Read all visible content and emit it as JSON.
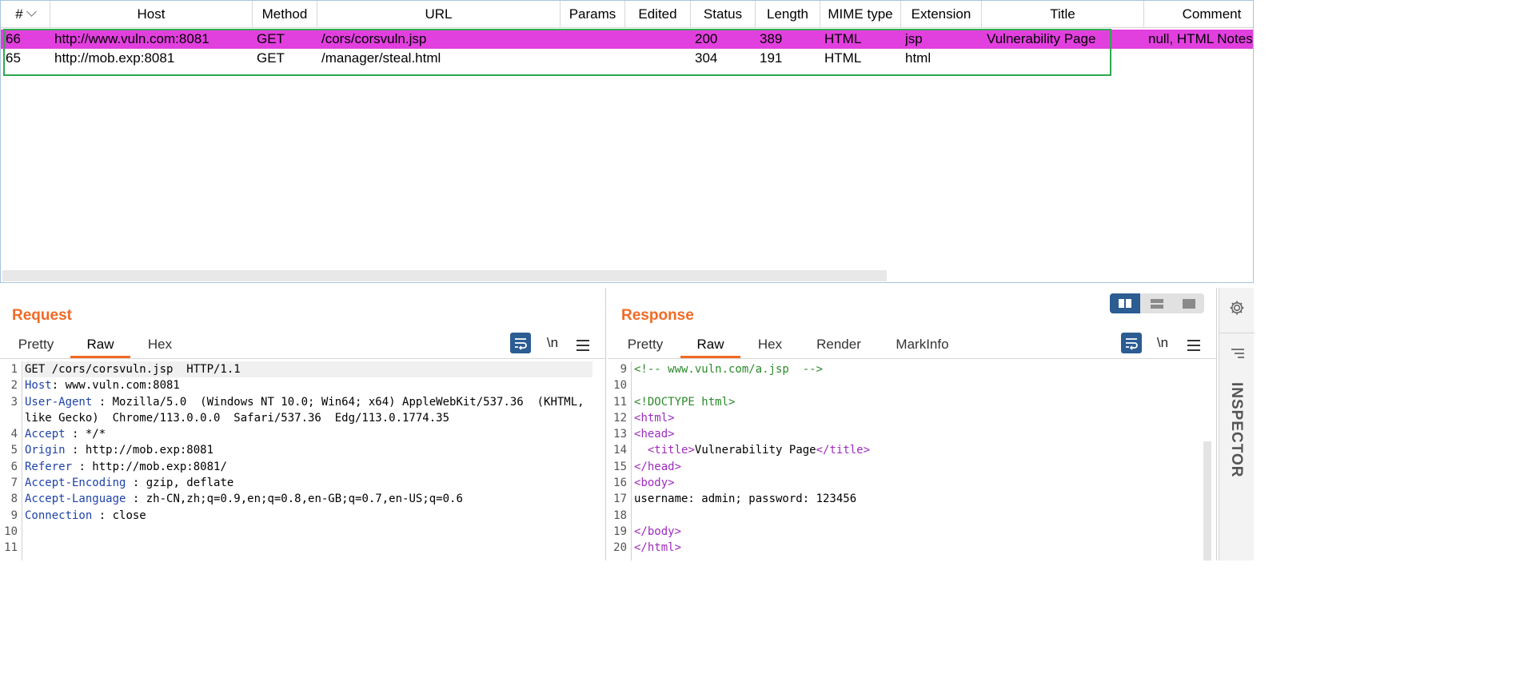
{
  "table": {
    "columns": [
      {
        "key": "num",
        "label": "#"
      },
      {
        "key": "host",
        "label": "Host"
      },
      {
        "key": "method",
        "label": "Method"
      },
      {
        "key": "url",
        "label": "URL"
      },
      {
        "key": "params",
        "label": "Params"
      },
      {
        "key": "edited",
        "label": "Edited"
      },
      {
        "key": "status",
        "label": "Status"
      },
      {
        "key": "length",
        "label": "Length"
      },
      {
        "key": "mime",
        "label": "MIME type"
      },
      {
        "key": "ext",
        "label": "Extension"
      },
      {
        "key": "title",
        "label": "Title"
      },
      {
        "key": "comment",
        "label": "Comment"
      }
    ],
    "rows": [
      {
        "num": "66",
        "host": "http://www.vuln.com:8081",
        "method": "GET",
        "url": "/cors/corsvuln.jsp",
        "params": "",
        "edited": "",
        "status": "200",
        "length": "389",
        "mime": "HTML",
        "ext": "jsp",
        "title": "Vulnerability Page",
        "comment": "null, HTML Notes",
        "selected": true
      },
      {
        "num": "65",
        "host": "http://mob.exp:8081",
        "method": "GET",
        "url": "/manager/steal.html",
        "params": "",
        "edited": "",
        "status": "304",
        "length": "191",
        "mime": "HTML",
        "ext": "html",
        "title": "",
        "comment": "",
        "selected": false
      }
    ]
  },
  "request": {
    "title": "Request",
    "tabs": [
      "Pretty",
      "Raw",
      "Hex"
    ],
    "active_tab": "Raw",
    "newline_label": "\\n",
    "lines": [
      {
        "n": "1",
        "parts": [
          {
            "t": "GET /cors/corsvuln.jsp  HTTP/1.1",
            "c": ""
          }
        ]
      },
      {
        "n": "2",
        "parts": [
          {
            "t": "Host",
            "c": "key"
          },
          {
            "t": ": www.vuln.com:8081",
            "c": ""
          }
        ]
      },
      {
        "n": "3",
        "parts": [
          {
            "t": "User-Agent",
            "c": "key"
          },
          {
            "t": " : Mozilla/5.0  (Windows NT 10.0; Win64; x64) AppleWebKit/537.36  (KHTML,",
            "c": ""
          }
        ]
      },
      {
        "n": "",
        "parts": [
          {
            "t": "like Gecko)  Chrome/113.0.0.0  Safari/537.36  Edg/113.0.1774.35",
            "c": ""
          }
        ]
      },
      {
        "n": "4",
        "parts": [
          {
            "t": "Accept",
            "c": "key"
          },
          {
            "t": " : */*",
            "c": ""
          }
        ]
      },
      {
        "n": "5",
        "parts": [
          {
            "t": "Origin",
            "c": "key"
          },
          {
            "t": " : http://mob.exp:8081",
            "c": ""
          }
        ]
      },
      {
        "n": "6",
        "parts": [
          {
            "t": "Referer",
            "c": "key"
          },
          {
            "t": " : http://mob.exp:8081/",
            "c": ""
          }
        ]
      },
      {
        "n": "7",
        "parts": [
          {
            "t": "Accept-Encoding",
            "c": "key"
          },
          {
            "t": " : gzip, deflate",
            "c": ""
          }
        ]
      },
      {
        "n": "8",
        "parts": [
          {
            "t": "Accept-Language",
            "c": "key"
          },
          {
            "t": " : zh-CN,zh;q=0.9,en;q=0.8,en-GB;q=0.7,en-US;q=0.6",
            "c": ""
          }
        ]
      },
      {
        "n": "9",
        "parts": [
          {
            "t": "Connection",
            "c": "key"
          },
          {
            "t": " : close",
            "c": ""
          }
        ]
      },
      {
        "n": "10",
        "parts": []
      },
      {
        "n": "11",
        "parts": []
      }
    ]
  },
  "response": {
    "title": "Response",
    "tabs": [
      "Pretty",
      "Raw",
      "Hex",
      "Render",
      "MarkInfo"
    ],
    "active_tab": "Raw",
    "newline_label": "\\n",
    "lines": [
      {
        "n": "9",
        "parts": [
          {
            "t": "<!-- www.vuln.com/a.jsp  -->",
            "c": "cmt"
          }
        ]
      },
      {
        "n": "10",
        "parts": []
      },
      {
        "n": "11",
        "parts": [
          {
            "t": "<!DOCTYPE html>",
            "c": "cmt"
          }
        ]
      },
      {
        "n": "12",
        "parts": [
          {
            "t": "<",
            "c": "tag"
          },
          {
            "t": "html",
            "c": "tag"
          },
          {
            "t": ">",
            "c": "tag"
          }
        ]
      },
      {
        "n": "13",
        "parts": [
          {
            "t": "<",
            "c": "tag"
          },
          {
            "t": "head",
            "c": "tag"
          },
          {
            "t": ">",
            "c": "tag"
          }
        ]
      },
      {
        "n": "14",
        "parts": [
          {
            "t": "  <",
            "c": "tag"
          },
          {
            "t": "title",
            "c": "tag"
          },
          {
            "t": ">",
            "c": "tag"
          },
          {
            "t": "Vulnerability Page",
            "c": ""
          },
          {
            "t": "</",
            "c": "tag"
          },
          {
            "t": "title",
            "c": "tag"
          },
          {
            "t": ">",
            "c": "tag"
          }
        ]
      },
      {
        "n": "15",
        "parts": [
          {
            "t": "</",
            "c": "tag"
          },
          {
            "t": "head",
            "c": "tag"
          },
          {
            "t": ">",
            "c": "tag"
          }
        ]
      },
      {
        "n": "16",
        "parts": [
          {
            "t": "<",
            "c": "tag"
          },
          {
            "t": "body",
            "c": "tag"
          },
          {
            "t": ">",
            "c": "tag"
          }
        ]
      },
      {
        "n": "17",
        "parts": [
          {
            "t": "username: admin; password: 123456",
            "c": ""
          }
        ]
      },
      {
        "n": "18",
        "parts": []
      },
      {
        "n": "19",
        "parts": [
          {
            "t": "</",
            "c": "tag"
          },
          {
            "t": "body",
            "c": "tag"
          },
          {
            "t": ">",
            "c": "tag"
          }
        ]
      },
      {
        "n": "20",
        "parts": [
          {
            "t": "</",
            "c": "tag"
          },
          {
            "t": "html",
            "c": "tag"
          },
          {
            "t": ">",
            "c": "tag"
          }
        ]
      }
    ]
  },
  "inspector": {
    "label": "INSPECTOR"
  },
  "icons": {
    "settings": "gear-icon",
    "inspector_menu": "menu-lines-icon",
    "wrap": "word-wrap-icon",
    "menu": "hamburger-icon",
    "view_split": "split-columns-icon",
    "view_rows": "split-rows-icon",
    "view_single": "single-pane-icon"
  },
  "colors": {
    "selected_row": "#e23fdf",
    "highlight_box": "#2fa84f",
    "accent": "#f26a25",
    "button_blue": "#2b5c92"
  }
}
